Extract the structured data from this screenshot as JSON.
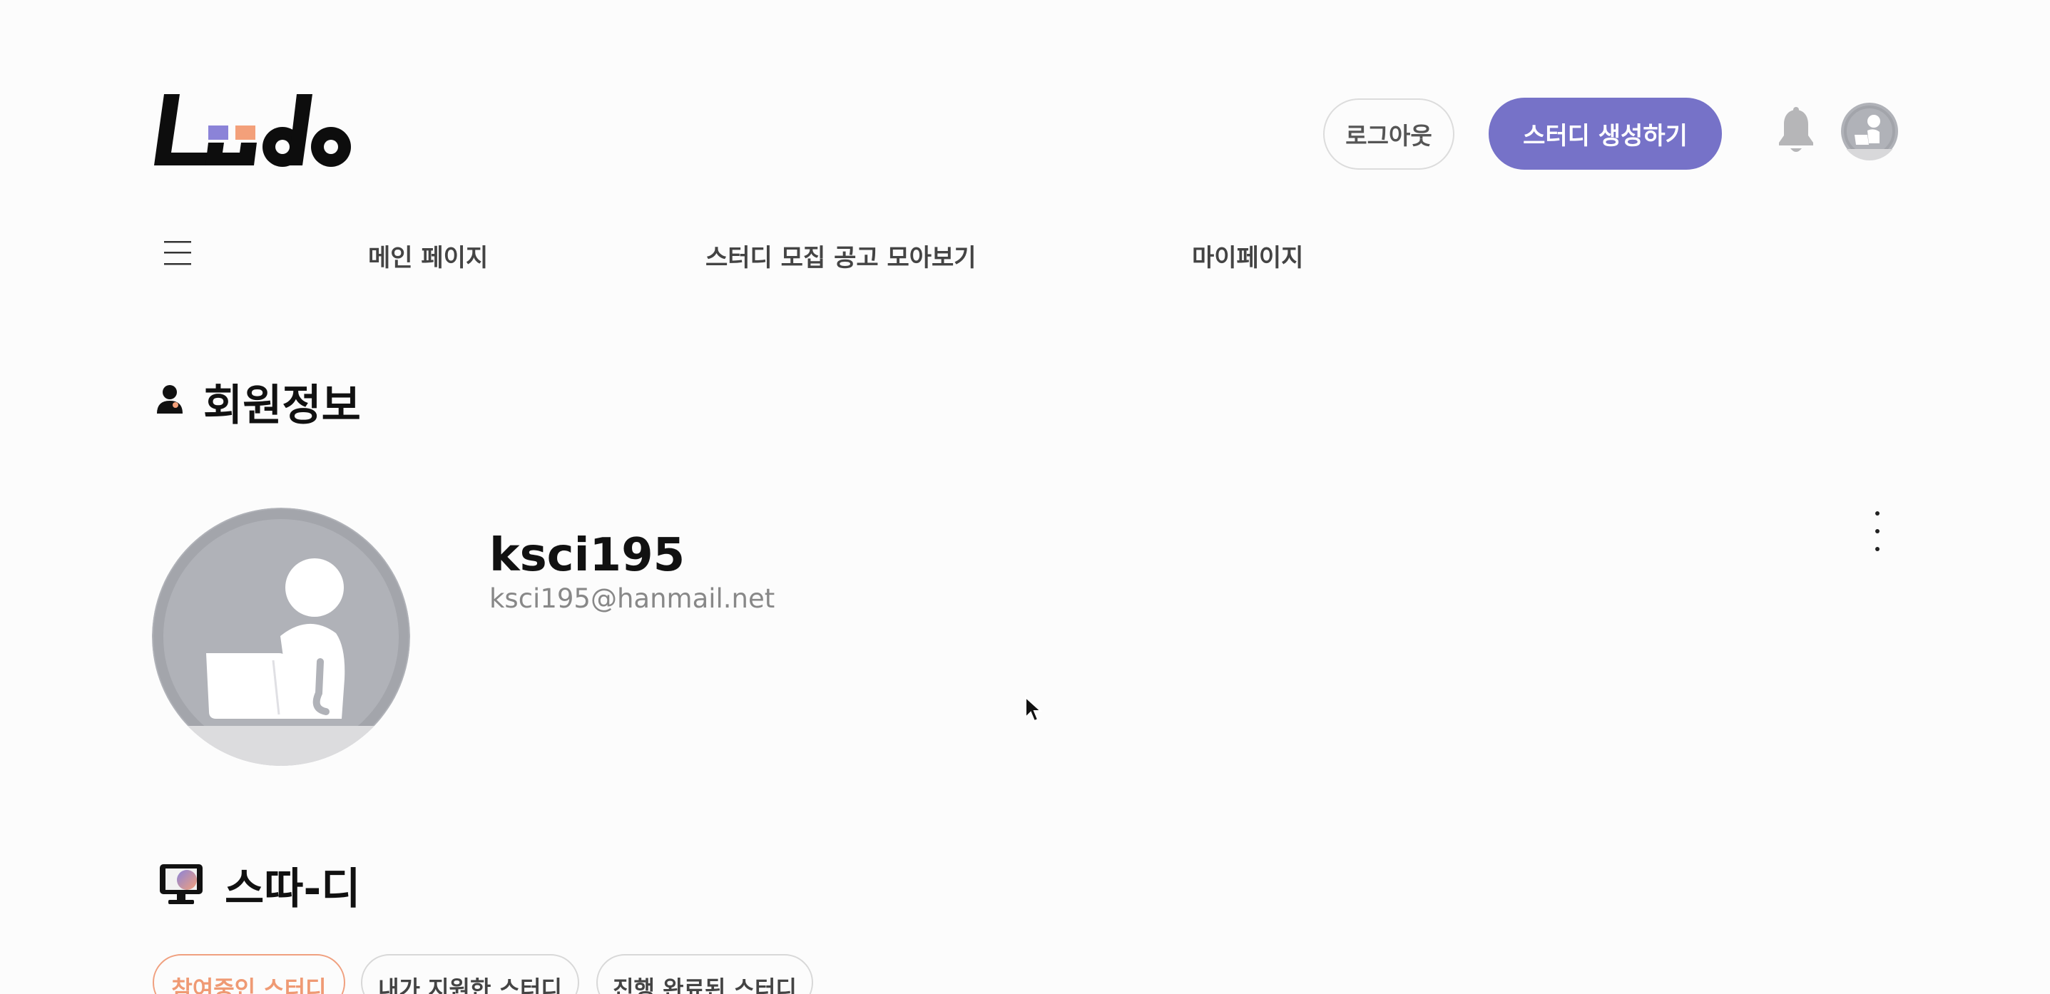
{
  "header": {
    "logo_text": "Ludo",
    "logout_label": "로그아웃",
    "create_study_label": "스터디 생성하기",
    "icons": {
      "notifications": "bell-icon",
      "profile": "avatar-icon"
    },
    "colors": {
      "brand": "#7672c8",
      "accent": "#f3a07a"
    }
  },
  "nav": {
    "menu_icon": "hamburger-icon",
    "items": [
      {
        "label": "메인 페이지"
      },
      {
        "label": "스터디 모집 공고 모아보기"
      },
      {
        "label": "마이페이지"
      }
    ]
  },
  "member_info": {
    "title": "회원정보",
    "icon": "user-icon",
    "username": "ksci195",
    "email": "ksci195@hanmail.net",
    "more_icon": "vertical-ellipsis-icon"
  },
  "study": {
    "title": "스따-디",
    "icon": "monitor-icon",
    "tabs": [
      {
        "label": "참여중인 스터디",
        "active": true
      },
      {
        "label": "내가 지원한 스터디",
        "active": false
      },
      {
        "label": "진행 완료된 스터디",
        "active": false
      }
    ]
  }
}
